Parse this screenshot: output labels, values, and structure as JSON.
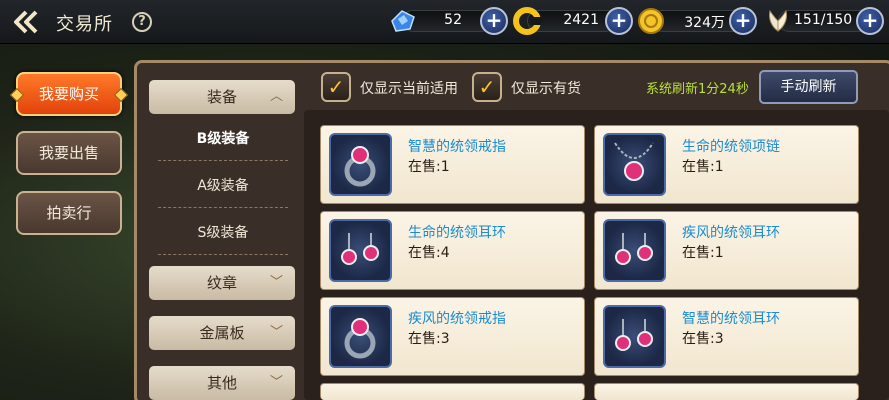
{
  "header": {
    "title": "交易所",
    "help_symbol": "?",
    "back_icon": "back-arrow-icon"
  },
  "resources": [
    {
      "icon": "blue-crystal-icon",
      "value": "52"
    },
    {
      "icon": "gold-c-coin-icon",
      "value": "2421"
    },
    {
      "icon": "gold-coin-icon",
      "value": "324万"
    },
    {
      "icon": "wing-stamina-icon",
      "value": "151/150"
    }
  ],
  "left_tabs": [
    {
      "label": "我要购买",
      "active": true
    },
    {
      "label": "我要出售",
      "active": false
    },
    {
      "label": "拍卖行",
      "active": false
    }
  ],
  "categories": {
    "equipment": "装备",
    "sub_items": [
      "B级装备",
      "A级装备",
      "S级装备"
    ],
    "emblem": "纹章",
    "metal_plate": "金属板",
    "other": "其他"
  },
  "filters": {
    "show_applicable": "仅显示当前适用",
    "show_in_stock": "仅显示有货"
  },
  "refresh": {
    "timer": "系统刷新1分24秒",
    "button": "手动刷新"
  },
  "items": [
    {
      "name": "智慧的统领戒指",
      "stock": "在售:1",
      "icon": "ring-icon"
    },
    {
      "name": "生命的统领项链",
      "stock": "在售:1",
      "icon": "necklace-icon"
    },
    {
      "name": "生命的统领耳环",
      "stock": "在售:4",
      "icon": "earring-icon"
    },
    {
      "name": "疾风的统领耳环",
      "stock": "在售:1",
      "icon": "earring-icon"
    },
    {
      "name": "疾风的统领戒指",
      "stock": "在售:3",
      "icon": "ring-icon"
    },
    {
      "name": "智慧的统领耳环",
      "stock": "在售:3",
      "icon": "earring-icon"
    }
  ],
  "colors": {
    "accent_orange": "#e2420a",
    "item_name_blue": "#1c8ccf",
    "timer_green": "#b8e23a",
    "check_gold": "#ffc51e"
  }
}
